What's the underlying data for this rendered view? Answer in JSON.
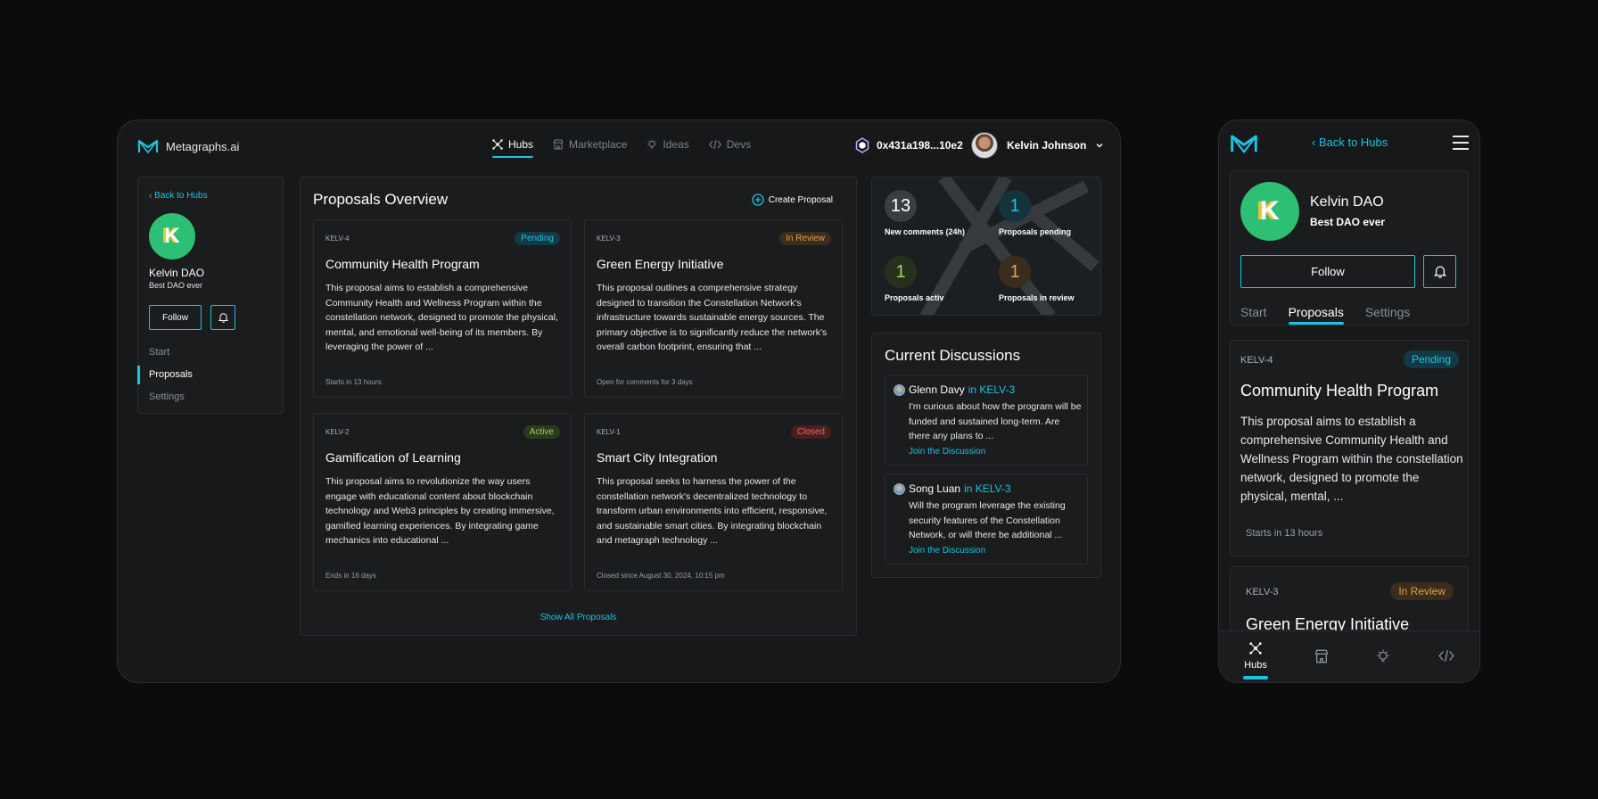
{
  "brand": {
    "name": "Metagraphs.ai",
    "accent": "#1ec3e0"
  },
  "nav": [
    {
      "label": "Hubs",
      "icon": "hubs-icon",
      "active": true
    },
    {
      "label": "Marketplace",
      "icon": "store-icon",
      "active": false
    },
    {
      "label": "Ideas",
      "icon": "lightbulb-icon",
      "active": false
    },
    {
      "label": "Devs",
      "icon": "code-icon",
      "active": false
    }
  ],
  "wallet": {
    "address": "0x431a198...10e2"
  },
  "user": {
    "name": "Kelvin Johnson"
  },
  "dao": {
    "initial": "K",
    "name": "Kelvin DAO",
    "subtitle": "Best DAO ever",
    "back_label": "Back to Hubs",
    "follow_label": "Follow"
  },
  "side_nav": [
    {
      "label": "Start",
      "selected": false
    },
    {
      "label": "Proposals",
      "selected": true
    },
    {
      "label": "Settings",
      "selected": false
    }
  ],
  "proposals": {
    "title": "Proposals Overview",
    "create_label": "Create Proposal",
    "show_all_label": "Show All Proposals",
    "items": [
      {
        "id": "KELV-4",
        "status": "Pending",
        "title": "Community Health Program",
        "description": "This proposal aims to establish a comprehensive Community Health and Wellness Program within the constellation network, designed to promote the physical, mental, and emotional well-being of its members. By leveraging the power of ...",
        "footer": "Starts in 13 hours"
      },
      {
        "id": "KELV-3",
        "status": "In Review",
        "title": "Green Energy Initiative",
        "description": "This proposal outlines a comprehensive strategy designed to transition the Constellation Network's infrastructure towards sustainable energy sources. The primary objective is to significantly reduce the network's overall carbon footprint, ensuring that ...",
        "footer": "Open for comments for 3 days"
      },
      {
        "id": "KELV-2",
        "status": "Active",
        "title": "Gamification of Learning",
        "description": "This proposal aims to revolutionize the way users engage with educational content about blockchain technology and Web3 principles by creating immersive, gamified learning experiences. By integrating game mechanics into educational ...",
        "footer": "Ends in 16 days"
      },
      {
        "id": "KELV-1",
        "status": "Closed",
        "title": "Smart City Integration",
        "description": "This proposal seeks to harness the power of the constellation network's decentralized technology to transform urban environments into efficient, responsive, and sustainable smart cities. By integrating blockchain and metagraph technology ...",
        "footer": "Closed since August 30, 2024, 10:15 pm"
      }
    ]
  },
  "stats": [
    {
      "value": "13",
      "label": "New comments (24h)"
    },
    {
      "value": "1",
      "label": "Proposals pending"
    },
    {
      "value": "1",
      "label": "Proposals activ"
    },
    {
      "value": "1",
      "label": "Proposals in review"
    }
  ],
  "discussions": {
    "title": "Current Discussions",
    "join_label": "Join the Discussion",
    "items": [
      {
        "author": "Glenn Davy",
        "context": "in KELV-3",
        "message": "I'm curious about how the program will be funded and sustained long-term. Are there any plans to ..."
      },
      {
        "author": "Song Luan",
        "context": "in KELV-3",
        "message": "Will the program leverage the existing security features of the Constellation Network, or will there be additional ..."
      }
    ]
  },
  "mobile": {
    "back_label": "Back to Hubs",
    "tabs": [
      "Start",
      "Proposals",
      "Settings"
    ],
    "tabbar": [
      {
        "label": "Hubs"
      }
    ],
    "cards": [
      {
        "id": "KELV-4",
        "status": "Pending",
        "title": "Community Health Program",
        "description": "This proposal aims to establish a comprehensive Community Health and Wellness Program within the constellation network, designed to promote the physical, mental, ...",
        "footer": "Starts in 13 hours"
      },
      {
        "id": "KELV-3",
        "status": "In Review",
        "title": "Green Energy Initiative"
      }
    ]
  }
}
